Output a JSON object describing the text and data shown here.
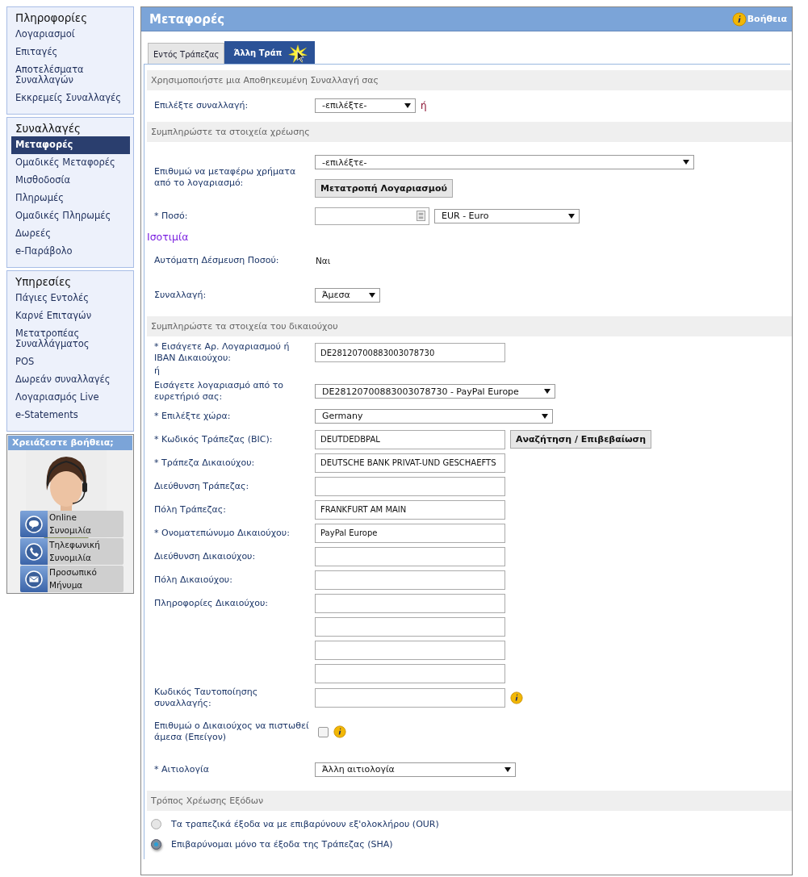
{
  "sidebar": {
    "groups": [
      {
        "title": "Πληροφορίες",
        "items": [
          {
            "label": "Λογαριασμοί",
            "selected": false
          },
          {
            "label": "Επιταγές",
            "selected": false
          },
          {
            "label": "Αποτελέσματα Συναλλαγών",
            "selected": false
          },
          {
            "label": "Εκκρεμείς Συναλλαγές",
            "selected": false
          }
        ]
      },
      {
        "title": "Συναλλαγές",
        "items": [
          {
            "label": "Μεταφορές",
            "selected": true
          },
          {
            "label": "Ομαδικές Μεταφορές",
            "selected": false
          },
          {
            "label": "Μισθοδοσία",
            "selected": false
          },
          {
            "label": "Πληρωμές",
            "selected": false
          },
          {
            "label": "Ομαδικές Πληρωμές",
            "selected": false
          },
          {
            "label": "Δωρεές",
            "selected": false
          },
          {
            "label": "e-Παράβολο",
            "selected": false
          }
        ]
      },
      {
        "title": "Υπηρεσίες",
        "items": [
          {
            "label": "Πάγιες Εντολές",
            "selected": false
          },
          {
            "label": "Καρνέ Επιταγών",
            "selected": false
          },
          {
            "label": "Μετατροπέας Συναλλάγματος",
            "selected": false
          },
          {
            "label": "POS",
            "selected": false
          },
          {
            "label": "Δωρεάν συναλλαγές",
            "selected": false
          },
          {
            "label": "Λογαριασμός Live",
            "selected": false
          },
          {
            "label": "e-Statements",
            "selected": false
          }
        ]
      }
    ],
    "help": {
      "title": "Χρειάζεστε βοήθεια;",
      "actions": [
        {
          "kind": "chat",
          "label": "Online Συνομιλία"
        },
        {
          "kind": "phone",
          "label": "Τηλεφωνική Συνομιλία"
        },
        {
          "kind": "mail",
          "label": "Προσωπικό Μήνυμα"
        }
      ]
    }
  },
  "header": {
    "title": "Μεταφορές",
    "help": "Βοήθεια"
  },
  "tabs": [
    {
      "label": "Εντός Τράπεζας",
      "selected": false
    },
    {
      "label": "Άλλη Τράπ",
      "selected": true
    }
  ],
  "sections": [
    {
      "title": "Χρησιμοποιήστε μια Αποθηκευμένη Συναλλαγή σας",
      "rows": [
        {
          "kind": "select",
          "label": "Επιλέξτε συναλλαγή:",
          "value": "-επιλέξτε-",
          "suffix": "ή"
        }
      ]
    },
    {
      "title": "Συμπληρώστε τα στοιχεία χρέωσης",
      "rows": [
        {
          "kind": "select",
          "label": "Επιθυμώ να μεταφέρω χρήματα από το λογαριασμό:",
          "value": "-επιλέξτε-",
          "button": "Μετατροπή Λογαριασμού"
        },
        {
          "kind": "amount",
          "label": "* Ποσό:",
          "currency": "EUR - Euro"
        },
        {
          "kind": "link",
          "label": "Ισοτιμία"
        },
        {
          "kind": "static",
          "label": "Αυτόματη Δέσμευση Ποσού:",
          "value": "Ναι"
        },
        {
          "kind": "select",
          "label": "Συναλλαγή:",
          "value": "Άμεσα"
        }
      ]
    },
    {
      "title": "Συμπληρώστε τα στοιχεία του δικαιούχου",
      "rows": [
        {
          "kind": "input",
          "label": "* Εισάγετε Αρ. Λογαριασμού ή IBAN Δικαιούχου:",
          "value": "DE28120700883003078730"
        },
        {
          "kind": "note",
          "label": "ή"
        },
        {
          "kind": "select",
          "label": "Εισάγετε λογαριασμό από το ευρετήριό σας:",
          "value": "DE28120700883003078730 - PayPal Europe"
        },
        {
          "kind": "select",
          "label": "* Επιλέξτε χώρα:",
          "value": "Germany"
        },
        {
          "kind": "input",
          "label": "* Κωδικός Τράπεζας (BIC):",
          "value": "DEUTDEDBPAL",
          "button": "Αναζήτηση / Επιβεβαίωση"
        },
        {
          "kind": "input",
          "label": "* Τράπεζα Δικαιούχου:",
          "value": "DEUTSCHE BANK PRIVAT-UND GESCHAEFTS"
        },
        {
          "kind": "input",
          "label": "Διεύθυνση Τράπεζας:"
        },
        {
          "kind": "input",
          "label": "Πόλη Τράπεζας:",
          "value": "FRANKFURT AM MAIN"
        },
        {
          "kind": "input",
          "label": "* Ονοματεπώνυμο Δικαιούχου:",
          "value": "PayPal Europe"
        },
        {
          "kind": "input",
          "label": "Διεύθυνση Δικαιούχου:"
        },
        {
          "kind": "input",
          "label": "Πόλη Δικαιούχου:"
        },
        {
          "kind": "input",
          "label": "Πληροφορίες Δικαιούχου:"
        },
        {
          "kind": "input"
        },
        {
          "kind": "input"
        },
        {
          "kind": "input"
        },
        {
          "kind": "input",
          "label": "Κωδικός Ταυτοποίησης συναλλαγής:",
          "info": true
        },
        {
          "kind": "checkbox",
          "label": "Επιθυμώ ο Δικαιούχος να πιστωθεί άμεσα (Επείγον)",
          "checked": false,
          "info": true
        },
        {
          "kind": "select",
          "label": "* Αιτιολογία",
          "value": "Άλλη αιτιολογία"
        }
      ]
    },
    {
      "title": "Τρόπος Χρέωσης Εξόδων",
      "rows": [
        {
          "kind": "radio",
          "label": "Τα τραπεζικά έξοδα να με επιβαρύνουν εξ'ολοκλήρου (OUR)",
          "selected": false
        },
        {
          "kind": "radio",
          "label": "Επιβαρύνομαι μόνο τα έξοδα της Τράπεζας (SHA)",
          "selected": true
        }
      ]
    }
  ]
}
